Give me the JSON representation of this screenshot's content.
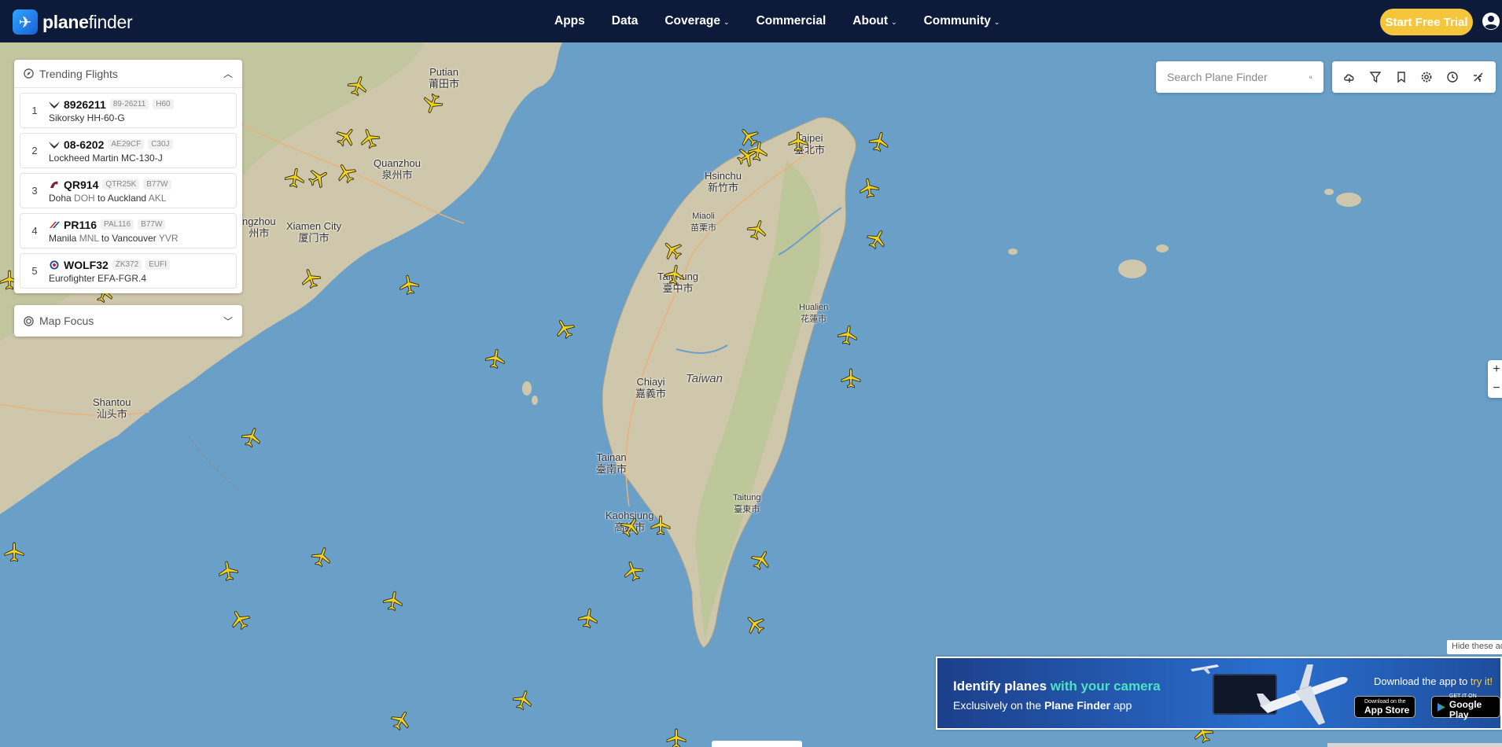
{
  "brand": {
    "name_bold": "plane",
    "name_rest": "finder"
  },
  "nav": [
    {
      "label": "Apps",
      "dropdown": false
    },
    {
      "label": "Data",
      "dropdown": false
    },
    {
      "label": "Coverage",
      "dropdown": true
    },
    {
      "label": "Commercial",
      "dropdown": false
    },
    {
      "label": "About",
      "dropdown": true
    },
    {
      "label": "Community",
      "dropdown": true
    }
  ],
  "cta": {
    "label": "Start Free Trial"
  },
  "trending": {
    "title": "Trending Flights",
    "flights": [
      {
        "rank": "1",
        "callsign": "8926211",
        "tags": [
          "89-26211",
          "H60"
        ],
        "line": "Sikorsky HH-60-G",
        "from_code": "",
        "to_code": "",
        "icon": "military-eagle-icon"
      },
      {
        "rank": "2",
        "callsign": "08-6202",
        "tags": [
          "AE29CF",
          "C30J"
        ],
        "line": "Lockheed Martin MC-130-J",
        "from_code": "",
        "to_code": "",
        "icon": "military-eagle-icon"
      },
      {
        "rank": "3",
        "callsign": "QR914",
        "tags": [
          "QTR25K",
          "B77W"
        ],
        "route": {
          "from": "Doha",
          "from_code": "DOH",
          "to": "Auckland",
          "to_code": "AKL"
        },
        "icon": "qatar-logo-icon"
      },
      {
        "rank": "4",
        "callsign": "PR116",
        "tags": [
          "PAL116",
          "B77W"
        ],
        "route": {
          "from": "Manila",
          "from_code": "MNL",
          "to": "Vancouver",
          "to_code": "YVR"
        },
        "icon": "pal-logo-icon"
      },
      {
        "rank": "5",
        "callsign": "WOLF32",
        "tags": [
          "ZK372",
          "EUFI"
        ],
        "line": "Eurofighter EFA-FGR.4",
        "from_code": "",
        "to_code": "",
        "icon": "raf-roundel-icon"
      }
    ]
  },
  "map_focus": {
    "title": "Map Focus"
  },
  "search": {
    "placeholder": "Search Plane Finder"
  },
  "tools": [
    "weather-cloud-icon",
    "filter-icon",
    "bookmark-icon",
    "settings-gear-icon",
    "history-clock-icon",
    "playback-plane-icon"
  ],
  "zoom": {
    "in": "+",
    "out": "−"
  },
  "map_labels": [
    {
      "en": "Putian",
      "zh": "莆田市"
    },
    {
      "en": "Quanzhou",
      "zh": "泉州市"
    },
    {
      "en": "Xiamen City",
      "zh": "厦门市"
    },
    {
      "en": "ngzhou",
      "zh": "州市"
    },
    {
      "en": "Shantou",
      "zh": "汕头市"
    },
    {
      "en": "Taipei",
      "zh": "臺北市"
    },
    {
      "en": "Hsinchu",
      "zh": "新竹市"
    },
    {
      "en": "Miaoli",
      "zh": "苗栗市"
    },
    {
      "en": "Taichung",
      "zh": "臺中市"
    },
    {
      "en": "Hualien",
      "zh": "花蓮市"
    },
    {
      "en": "Chiayi",
      "zh": "嘉義市"
    },
    {
      "en": "Taiwan",
      "zh": ""
    },
    {
      "en": "Tainan",
      "zh": "臺南市"
    },
    {
      "en": "Taitung",
      "zh": "臺東市"
    },
    {
      "en": "Kaohsiung",
      "zh": "高雄市"
    }
  ],
  "ad": {
    "hide_label": "Hide these ads",
    "title_a": "Identify planes",
    "title_b": " with your camera",
    "sub_a": "Exclusively on the ",
    "sub_b": "Plane Finder",
    "sub_c": " app",
    "download_a": "Download the app to ",
    "download_b": "try it!",
    "appstore_small": "Download on the",
    "appstore_big": "App Store",
    "gplay_small": "GET IT ON",
    "gplay_big": "Google Play"
  },
  "colors": {
    "nav_bg": "#0d1a3a",
    "cta": "#f5c63b",
    "sea": "#6a9fc8",
    "land": "#cfc7ab",
    "plane": "#f2d21b"
  }
}
